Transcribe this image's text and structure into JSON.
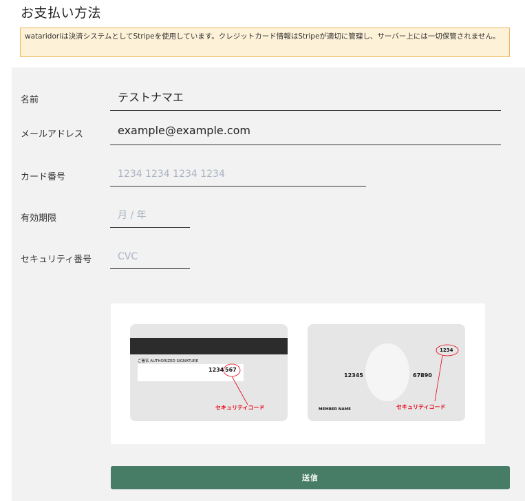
{
  "page": {
    "title": "お支払い方法"
  },
  "notice": {
    "text": "wataridoriは決済システムとしてStripeを使用しています。クレジットカード情報はStripeが適切に管理し、サーバー上には一切保管されません。"
  },
  "form": {
    "name": {
      "label": "名前",
      "value": "テストナマエ"
    },
    "email": {
      "label": "メールアドレス",
      "value": "example@example.com"
    },
    "card_number": {
      "label": "カード番号",
      "placeholder": "1234 1234 1234 1234"
    },
    "expiry": {
      "label": "有効期限",
      "placeholder": "月 / 年"
    },
    "cvc": {
      "label": "セキュリティ番号",
      "placeholder": "CVC"
    }
  },
  "card_illustration": {
    "back": {
      "signature_label": "ご署名 AUTHORIZED SIGNATURE",
      "number_prefix": "1234",
      "security_digits": "567",
      "caption": "セキュリティコード"
    },
    "front": {
      "number_left": "12345",
      "number_right": "67890",
      "security_digits": "1234",
      "member_name": "MEMBER NAME",
      "caption": "セキュリティコード"
    }
  },
  "actions": {
    "submit_label": "送信"
  },
  "colors": {
    "submit": "#477d66",
    "notice_bg": "#fdf1d8",
    "notice_border": "#f0b65d",
    "annotation": "#e60012"
  }
}
